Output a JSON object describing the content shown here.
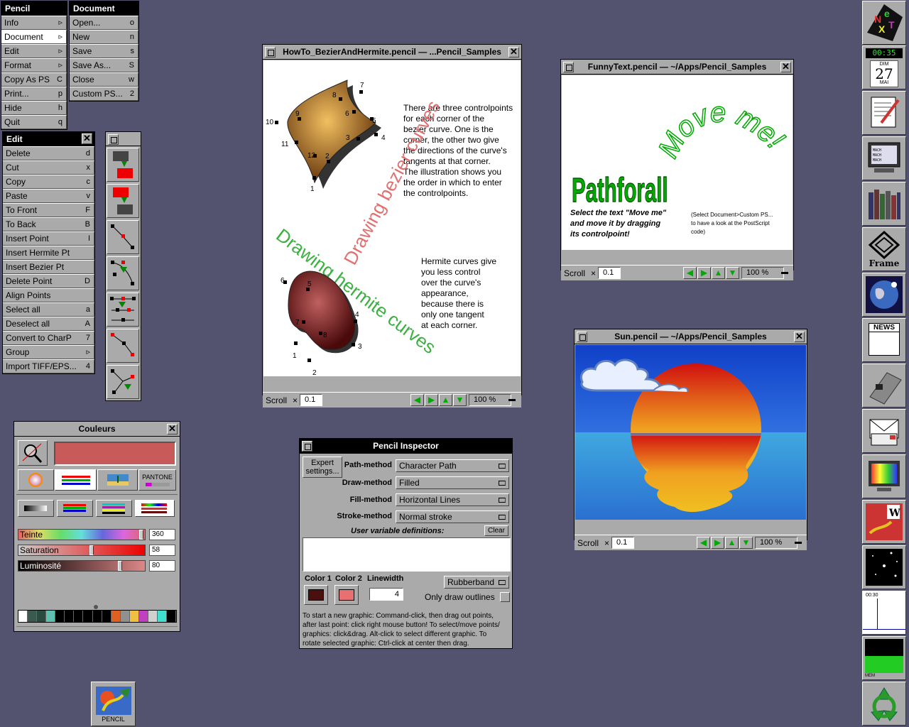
{
  "pencil_menu": {
    "title": "Pencil",
    "items": [
      {
        "label": "Info",
        "key": "▹"
      },
      {
        "label": "Document",
        "key": "▹"
      },
      {
        "label": "Edit",
        "key": "▹"
      },
      {
        "label": "Format",
        "key": "▹"
      },
      {
        "label": "Copy As PS",
        "key": "C"
      },
      {
        "label": "Print...",
        "key": "p"
      },
      {
        "label": "Hide",
        "key": "h"
      },
      {
        "label": "Quit",
        "key": "q"
      }
    ]
  },
  "document_menu": {
    "title": "Document",
    "items": [
      {
        "label": "Open...",
        "key": "o"
      },
      {
        "label": "New",
        "key": "n"
      },
      {
        "label": "Save",
        "key": "s"
      },
      {
        "label": "Save As...",
        "key": "S"
      },
      {
        "label": "Close",
        "key": "w"
      },
      {
        "label": "Custom PS...",
        "key": "2"
      }
    ]
  },
  "edit_menu": {
    "title": "Edit",
    "items": [
      {
        "label": "Delete",
        "key": "d"
      },
      {
        "label": "Cut",
        "key": "x"
      },
      {
        "label": "Copy",
        "key": "c"
      },
      {
        "label": "Paste",
        "key": "v"
      },
      {
        "label": "To Front",
        "key": "F"
      },
      {
        "label": "To Back",
        "key": "B"
      },
      {
        "label": "Insert Point",
        "key": "I"
      },
      {
        "label": "Insert Hermite Pt",
        "key": ""
      },
      {
        "label": "Insert Bezier Pt",
        "key": ""
      },
      {
        "label": "Delete Point",
        "key": "D"
      },
      {
        "label": "Align Points",
        "key": ""
      },
      {
        "label": "Select all",
        "key": "a"
      },
      {
        "label": "Deselect all",
        "key": "A"
      },
      {
        "label": "Convert to CharP",
        "key": "7"
      },
      {
        "label": "Group",
        "key": "▹"
      },
      {
        "label": "Import TIFF/EPS...",
        "key": "4"
      }
    ]
  },
  "bezier_window": {
    "title": "HowTo_BezierAndHermite.pencil  —  ...Pencil_Samples",
    "text1": [
      "There are three controlpoints",
      "for each corner of the",
      "bezier curve. One is the",
      "corner, the other two give",
      "the directions of the curve's",
      "tangents at that corner.",
      "The illustration shows you",
      "the order in which to enter",
      "the controlpoints."
    ],
    "text2": [
      "Hermite curves give",
      "you less control",
      "over the curve's",
      "appearance,",
      "because there is",
      "only one tangent",
      "at each corner."
    ],
    "diag1": "Drawing bezier curves",
    "diag2": "Drawing hermite curves",
    "bezier_labels": [
      "1",
      "2",
      "3",
      "4",
      "5",
      "6",
      "7",
      "8",
      "9",
      "10",
      "11",
      "12"
    ],
    "hermite_labels": [
      "1",
      "2",
      "3",
      "4",
      "5",
      "6",
      "7",
      "8"
    ],
    "scroll_label": "Scroll",
    "scroll_value": "0.1",
    "zoom": "100 %"
  },
  "funny_window": {
    "title": "FunnyText.pencil  —  ~/Apps/Pencil_Samples",
    "move_me": "Move me!",
    "pathforall": "Pathforall",
    "instr1": [
      "Select the text \"Move me\"",
      "and move it by dragging",
      "its controlpoint!"
    ],
    "instr2": [
      "(Select Document>Custom PS...",
      "to have a look at the PostScript",
      "code)"
    ],
    "scroll_label": "Scroll",
    "scroll_value": "0.1",
    "zoom": "100 %"
  },
  "sun_window": {
    "title": "Sun.pencil  —  ~/Apps/Pencil_Samples",
    "scroll_label": "Scroll",
    "scroll_value": "0.1",
    "zoom": "100 %"
  },
  "colors_panel": {
    "title": "Couleurs",
    "pantone": "PANTONE",
    "swatch_color": "#c85a5a",
    "sliders": [
      {
        "label": "Teinte",
        "value": "360",
        "level": 0.97
      },
      {
        "label": "Saturation",
        "value": "58",
        "level": 0.58
      },
      {
        "label": "Luminosité",
        "value": "80",
        "level": 0.8
      }
    ],
    "palette": [
      "#ffffff",
      "#3a5a50",
      "#2a4a40",
      "#60c0b0",
      "#000000",
      "#000000",
      "#000000",
      "#000000",
      "#000000",
      "#000000",
      "#e06020",
      "#909090",
      "#f0c040",
      "#c040c0",
      "#d0d0d0",
      "#40e0d0",
      "#000000"
    ]
  },
  "inspector": {
    "title": "Pencil Inspector",
    "expert": "Expert settings...",
    "rows": [
      {
        "label": "Path-method",
        "value": "Character Path"
      },
      {
        "label": "Draw-method",
        "value": "Filled"
      },
      {
        "label": "Fill-method",
        "value": "Horizontal Lines"
      },
      {
        "label": "Stroke-method",
        "value": "Normal stroke"
      }
    ],
    "user_var": "User variable definitions:",
    "clear": "Clear",
    "color1": "Color 1",
    "color2": "Color 2",
    "color1_value": "#4a1010",
    "color2_value": "#e87070",
    "linewidth_label": "Linewidth",
    "linewidth": "4",
    "rubberband": "Rubberband",
    "outline_label": "Only draw outlines",
    "help": [
      "To start a new graphic: Command-click, then drag out points,",
      "after last point: click right mouse button! To select/move points/",
      "graphics: click&drag. Alt-click to select different graphic. To",
      "rotate selected graphic: Ctrl-click at center then drag."
    ]
  },
  "dock": {
    "clock": "00:35",
    "cal_day": "DIM",
    "cal_date": "27",
    "cal_month": "MAI",
    "frame_label": "Frame",
    "news_label": "NEWS",
    "load_time": "00:30",
    "mem_label": "MEM"
  },
  "miniicon": {
    "label": "PENCIL"
  }
}
